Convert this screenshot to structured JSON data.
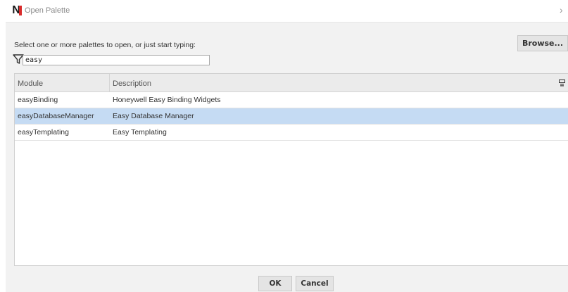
{
  "window": {
    "title": "Open Palette",
    "logo_letter": "N",
    "close_glyph": "›"
  },
  "dialog": {
    "prompt": "Select one or more palettes to open, or just start typing:",
    "browse_label": "Browse...",
    "filter": {
      "value": "easy",
      "icon": "filter-icon"
    }
  },
  "table": {
    "columns": [
      "Module",
      "Description"
    ],
    "column_chooser_icon": "column-chooser-icon",
    "rows": [
      {
        "module": "easyBinding",
        "description": "Honeywell Easy Binding Widgets",
        "selected": false
      },
      {
        "module": "easyDatabaseManager",
        "description": "Easy Database Manager",
        "selected": true
      },
      {
        "module": "easyTemplating",
        "description": "Easy Templating",
        "selected": false
      }
    ]
  },
  "buttons": {
    "ok": "OK",
    "cancel": "Cancel"
  },
  "colors": {
    "selection": "#c5dbf3",
    "dialog_bg": "#f2f2f2",
    "logo_red": "#d92b2b"
  }
}
